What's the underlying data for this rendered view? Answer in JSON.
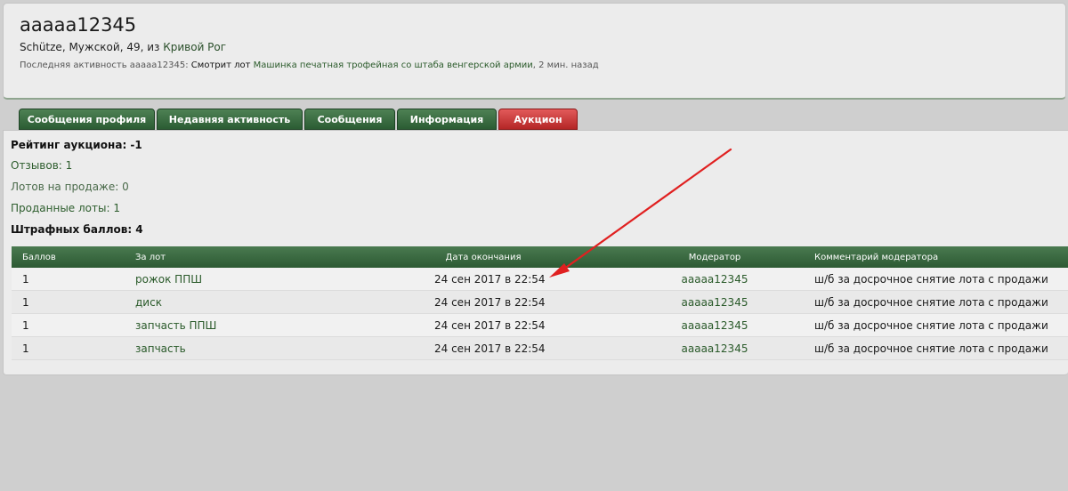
{
  "profile": {
    "username": "aaaaa12345",
    "info_prefix": "Schütze, Мужской, 49, из ",
    "city": "Кривой Рог",
    "activity_prefix": "Последняя активность aaaaa12345:",
    "activity_verb": "Смотрит лот",
    "activity_link": "Машинка печатная трофейная со штаба венгерской армии",
    "activity_suffix": ", 2 мин. назад"
  },
  "tabs": [
    {
      "label": "Сообщения профиля"
    },
    {
      "label": "Недавняя активность"
    },
    {
      "label": "Сообщения"
    },
    {
      "label": "Информация"
    },
    {
      "label": "Аукцион"
    }
  ],
  "auction": {
    "rating": "Рейтинг аукциона: -1",
    "reviews": "Отзывов: 1",
    "lots_for_sale": "Лотов на продаже: 0",
    "sold_lots": "Проданные лоты: 1",
    "penalty": "Штрафных баллов: 4"
  },
  "table": {
    "headers": {
      "points": "Баллов",
      "lot": "За лот",
      "end_date": "Дата окончания",
      "moderator": "Модератор",
      "comment": "Комментарий модератора"
    },
    "rows": [
      {
        "points": "1",
        "lot": "рожок ППШ",
        "end_date": "24 сен 2017 в 22:54",
        "moderator": "aaaaa12345",
        "comment": "ш/б за досрочное снятие лота с продажи"
      },
      {
        "points": "1",
        "lot": "диск",
        "end_date": "24 сен 2017 в 22:54",
        "moderator": "aaaaa12345",
        "comment": "ш/б за досрочное снятие лота с продажи"
      },
      {
        "points": "1",
        "lot": "запчасть ППШ",
        "end_date": "24 сен 2017 в 22:54",
        "moderator": "aaaaa12345",
        "comment": "ш/б за досрочное снятие лота с продажи"
      },
      {
        "points": "1",
        "lot": "запчасть",
        "end_date": "24 сен 2017 в 22:54",
        "moderator": "aaaaa12345",
        "comment": "ш/б за досрочное снятие лота с продажи"
      }
    ]
  },
  "colors": {
    "tab_green": "#2b5c33",
    "tab_active_red": "#b42626",
    "link_green": "#2a5a2a",
    "annotation_arrow": "#e02020"
  }
}
